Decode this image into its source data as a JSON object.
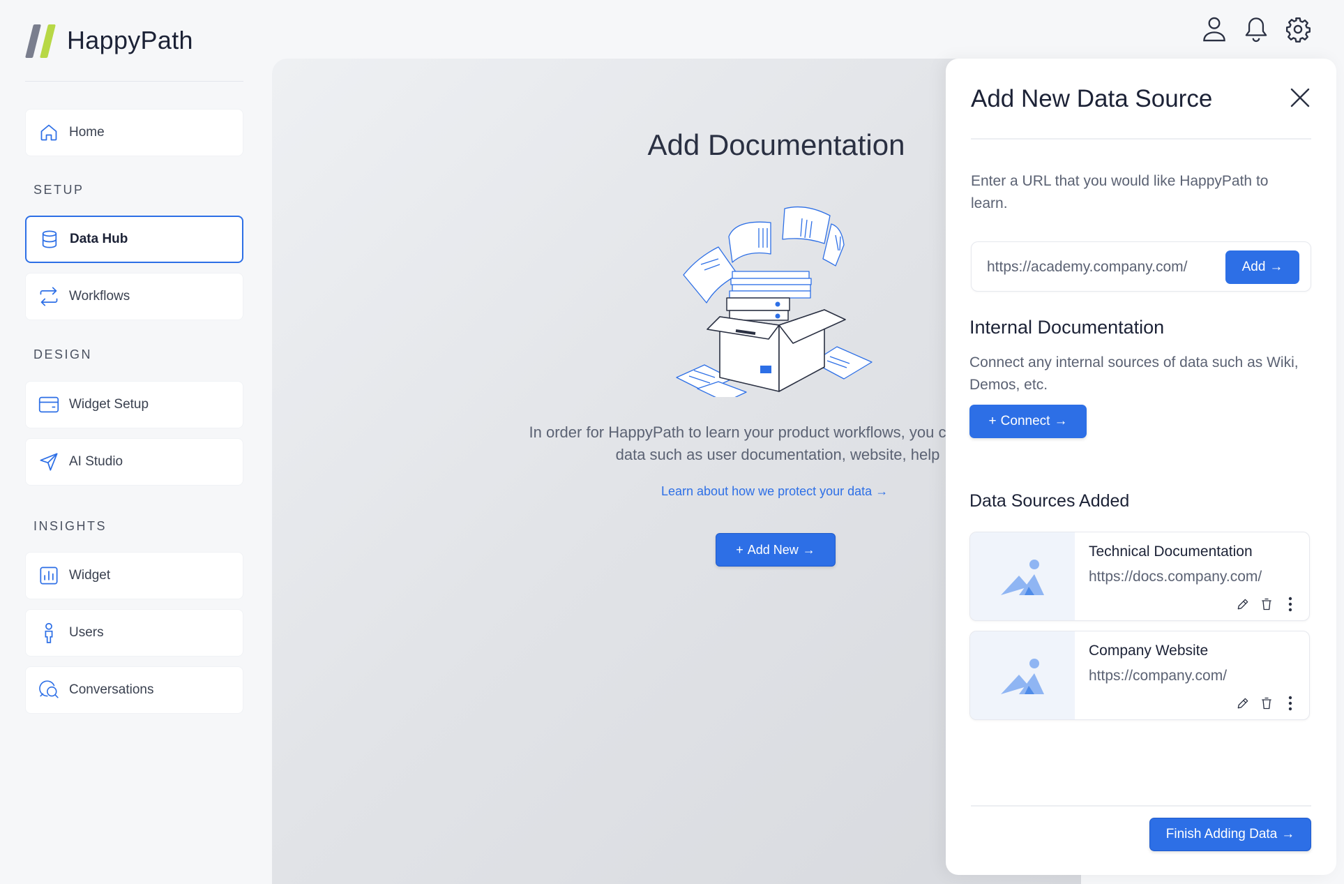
{
  "app": {
    "name": "HappyPath"
  },
  "sidebar": {
    "home": {
      "label": "Home",
      "icon": "home-icon"
    },
    "sections": {
      "setup": "SETUP",
      "design": "DESIGN",
      "insights": "INSIGHTS"
    },
    "items": {
      "data_hub": {
        "label": "Data Hub",
        "icon": "database-icon",
        "active": true
      },
      "workflows": {
        "label": "Workflows",
        "icon": "repeat-icon"
      },
      "widget_setup": {
        "label": "Widget Setup",
        "icon": "credit-card-icon"
      },
      "ai_studio": {
        "label": "AI Studio",
        "icon": "send-icon"
      },
      "widget": {
        "label": "Widget",
        "icon": "bar-chart-icon"
      },
      "users": {
        "label": "Users",
        "icon": "person-icon"
      },
      "conversations": {
        "label": "Conversations",
        "icon": "chat-search-icon"
      }
    }
  },
  "header": {
    "icons": [
      "user-icon",
      "bell-icon",
      "gear-icon"
    ]
  },
  "main": {
    "title": "Add Documentation",
    "description": "In order for HappyPath to learn your product workflows, you connect your data such as user documentation, website, help",
    "link": "Learn about how we protect your data",
    "add_new_label": "Add New"
  },
  "drawer": {
    "title": "Add New Data Source",
    "description": "Enter a URL that you would like HappyPath to learn.",
    "url_input": {
      "value": "https://academy.company.com/"
    },
    "add_label": "Add",
    "internal": {
      "title": "Internal Documentation",
      "description": "Connect any internal sources of data such as Wiki, Demos, etc.",
      "connect_label": "Connect"
    },
    "sources": {
      "title": "Data Sources Added",
      "items": [
        {
          "name": "Technical Documentation",
          "url": "https://docs.company.com/"
        },
        {
          "name": "Company Website",
          "url": "https://company.com/"
        }
      ]
    },
    "finish_label": "Finish Adding Data"
  },
  "colors": {
    "accent": "#2d6fe6",
    "logo_green": "#b7d846",
    "logo_gray": "#7a7e8e"
  }
}
